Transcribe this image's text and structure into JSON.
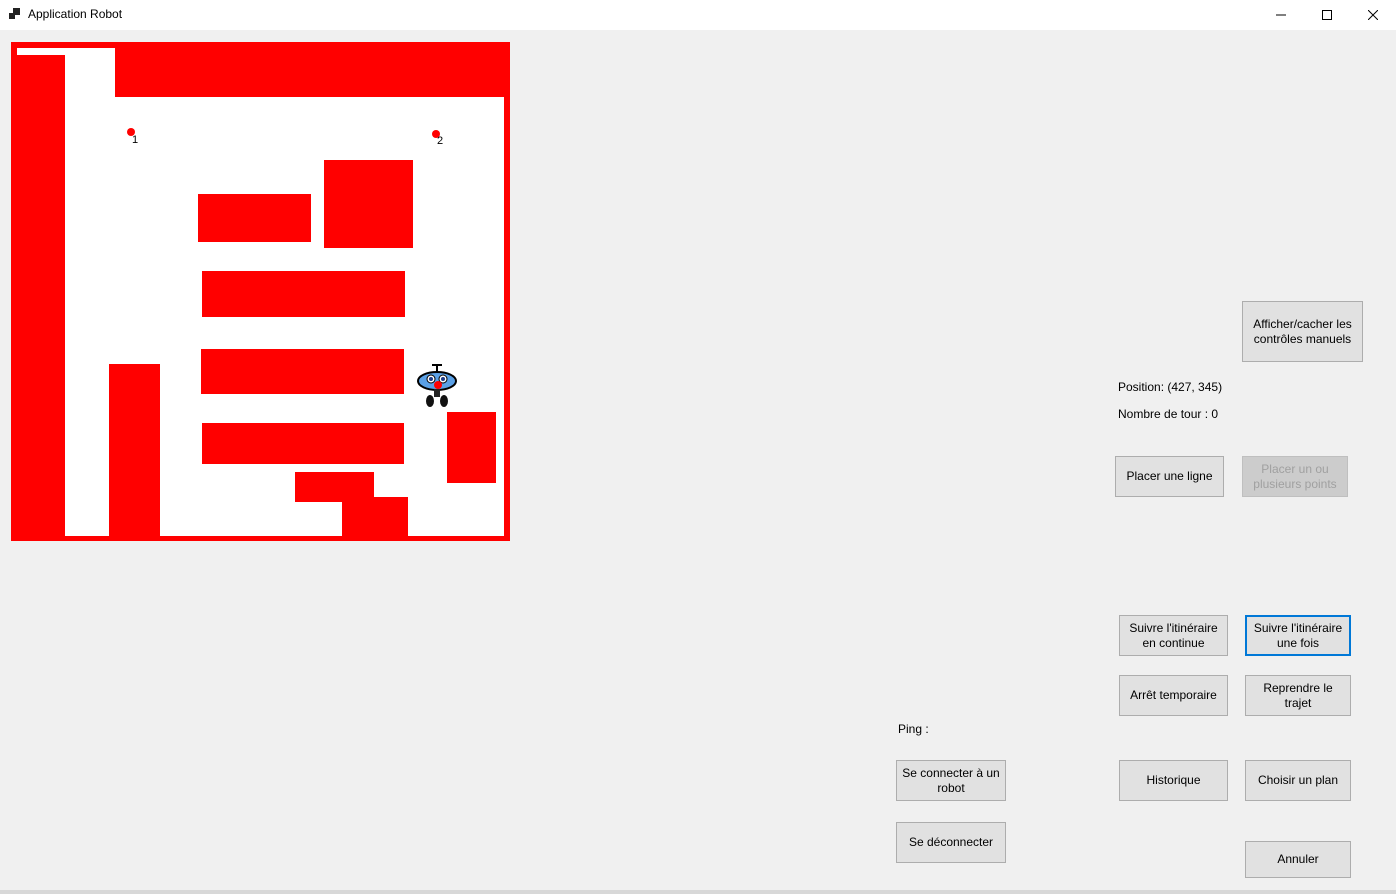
{
  "window": {
    "title": "Application Robot",
    "icon": "app-window-icon",
    "controls": [
      "minimize-icon",
      "maximize-icon",
      "close-icon"
    ]
  },
  "map": {
    "waypoints": [
      {
        "label": "1"
      },
      {
        "label": "2"
      }
    ],
    "robot_icon": "robot-icon",
    "colors": {
      "walls": "#ff0000",
      "floor": "#ffffff",
      "waypoint": "#ff0000"
    }
  },
  "panel": {
    "toggle_manual_label": "Afficher/cacher les contrôles manuels",
    "position_text": "Position: (427, 345)",
    "laps_text": "Nombre de tour : 0",
    "place_line_label": "Placer une ligne",
    "place_points_label": "Placer un ou plusieurs points",
    "follow_continuous_label": "Suivre l'itinéraire en continue",
    "follow_once_label": "Suivre l'itinéraire une fois",
    "pause_label": "Arrêt temporaire",
    "resume_label": "Reprendre le trajet",
    "history_label": "Historique",
    "choose_plan_label": "Choisir un plan",
    "cancel_label": "Annuler"
  },
  "connection": {
    "ping_label": "Ping :",
    "connect_label": "Se connecter à un robot",
    "disconnect_label": "Se déconnecter"
  },
  "colors": {
    "accent_focus": "#0078d7",
    "button_bg": "#e1e1e1",
    "window_bg": "#f0f0f0"
  }
}
